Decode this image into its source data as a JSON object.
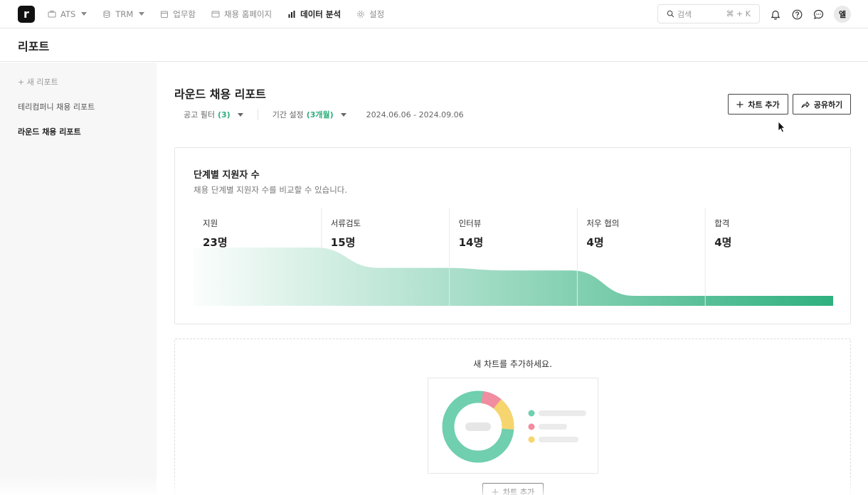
{
  "nav": {
    "logo_letter": "r",
    "items": [
      {
        "label": "ATS",
        "icon": "briefcase-icon",
        "dropdown": true
      },
      {
        "label": "TRM",
        "icon": "database-icon",
        "dropdown": true
      },
      {
        "label": "업무함",
        "icon": "calendar-icon",
        "dropdown": false
      },
      {
        "label": "채용 홈페이지",
        "icon": "browser-icon",
        "dropdown": false
      },
      {
        "label": "데이터 분석",
        "icon": "bar-chart-icon",
        "dropdown": false,
        "active": true
      },
      {
        "label": "설정",
        "icon": "gear-icon",
        "dropdown": false
      }
    ],
    "search_placeholder": "검색",
    "search_shortcut": "⌘ + K",
    "avatar_initial": "엘"
  },
  "page": {
    "title": "리포트"
  },
  "sidebar": {
    "new_report": "+ 새 리포트",
    "items": [
      {
        "label": "테리컴퍼니 채용 리포트",
        "active": false
      },
      {
        "label": "라운드 채용 리포트",
        "active": true
      }
    ]
  },
  "report": {
    "title": "라운드 채용 리포트",
    "filter_label": "공고 필터",
    "filter_count": "(3)",
    "period_label": "기간 설정",
    "period_value": "(3개월)",
    "date_range": "2024.06.06 - 2024.09.06",
    "add_chart_label": "차트 추가",
    "share_label": "공유하기"
  },
  "funnel_card": {
    "title": "단계별 지원자 수",
    "subtitle": "채용 단계별 지원자 수를 비교할 수 있습니다.",
    "stages": [
      {
        "label": "지원",
        "value": "23명"
      },
      {
        "label": "서류검토",
        "value": "15명"
      },
      {
        "label": "인터뷰",
        "value": "14명"
      },
      {
        "label": "처우 협의",
        "value": "4명"
      },
      {
        "label": "합격",
        "value": "4명"
      }
    ],
    "accent": "#2fb07e"
  },
  "chart_data": {
    "type": "area",
    "categories": [
      "지원",
      "서류검토",
      "인터뷰",
      "처우 협의",
      "합격"
    ],
    "values": [
      23,
      15,
      14,
      4,
      4
    ],
    "title": "단계별 지원자 수",
    "xlabel": "",
    "ylabel": ""
  },
  "new_chart": {
    "prompt": "새 차트를 추가하세요.",
    "button_label": "차트 추가",
    "donut_colors": [
      "#6fcfae",
      "#f28ca0",
      "#f7d56e"
    ]
  }
}
